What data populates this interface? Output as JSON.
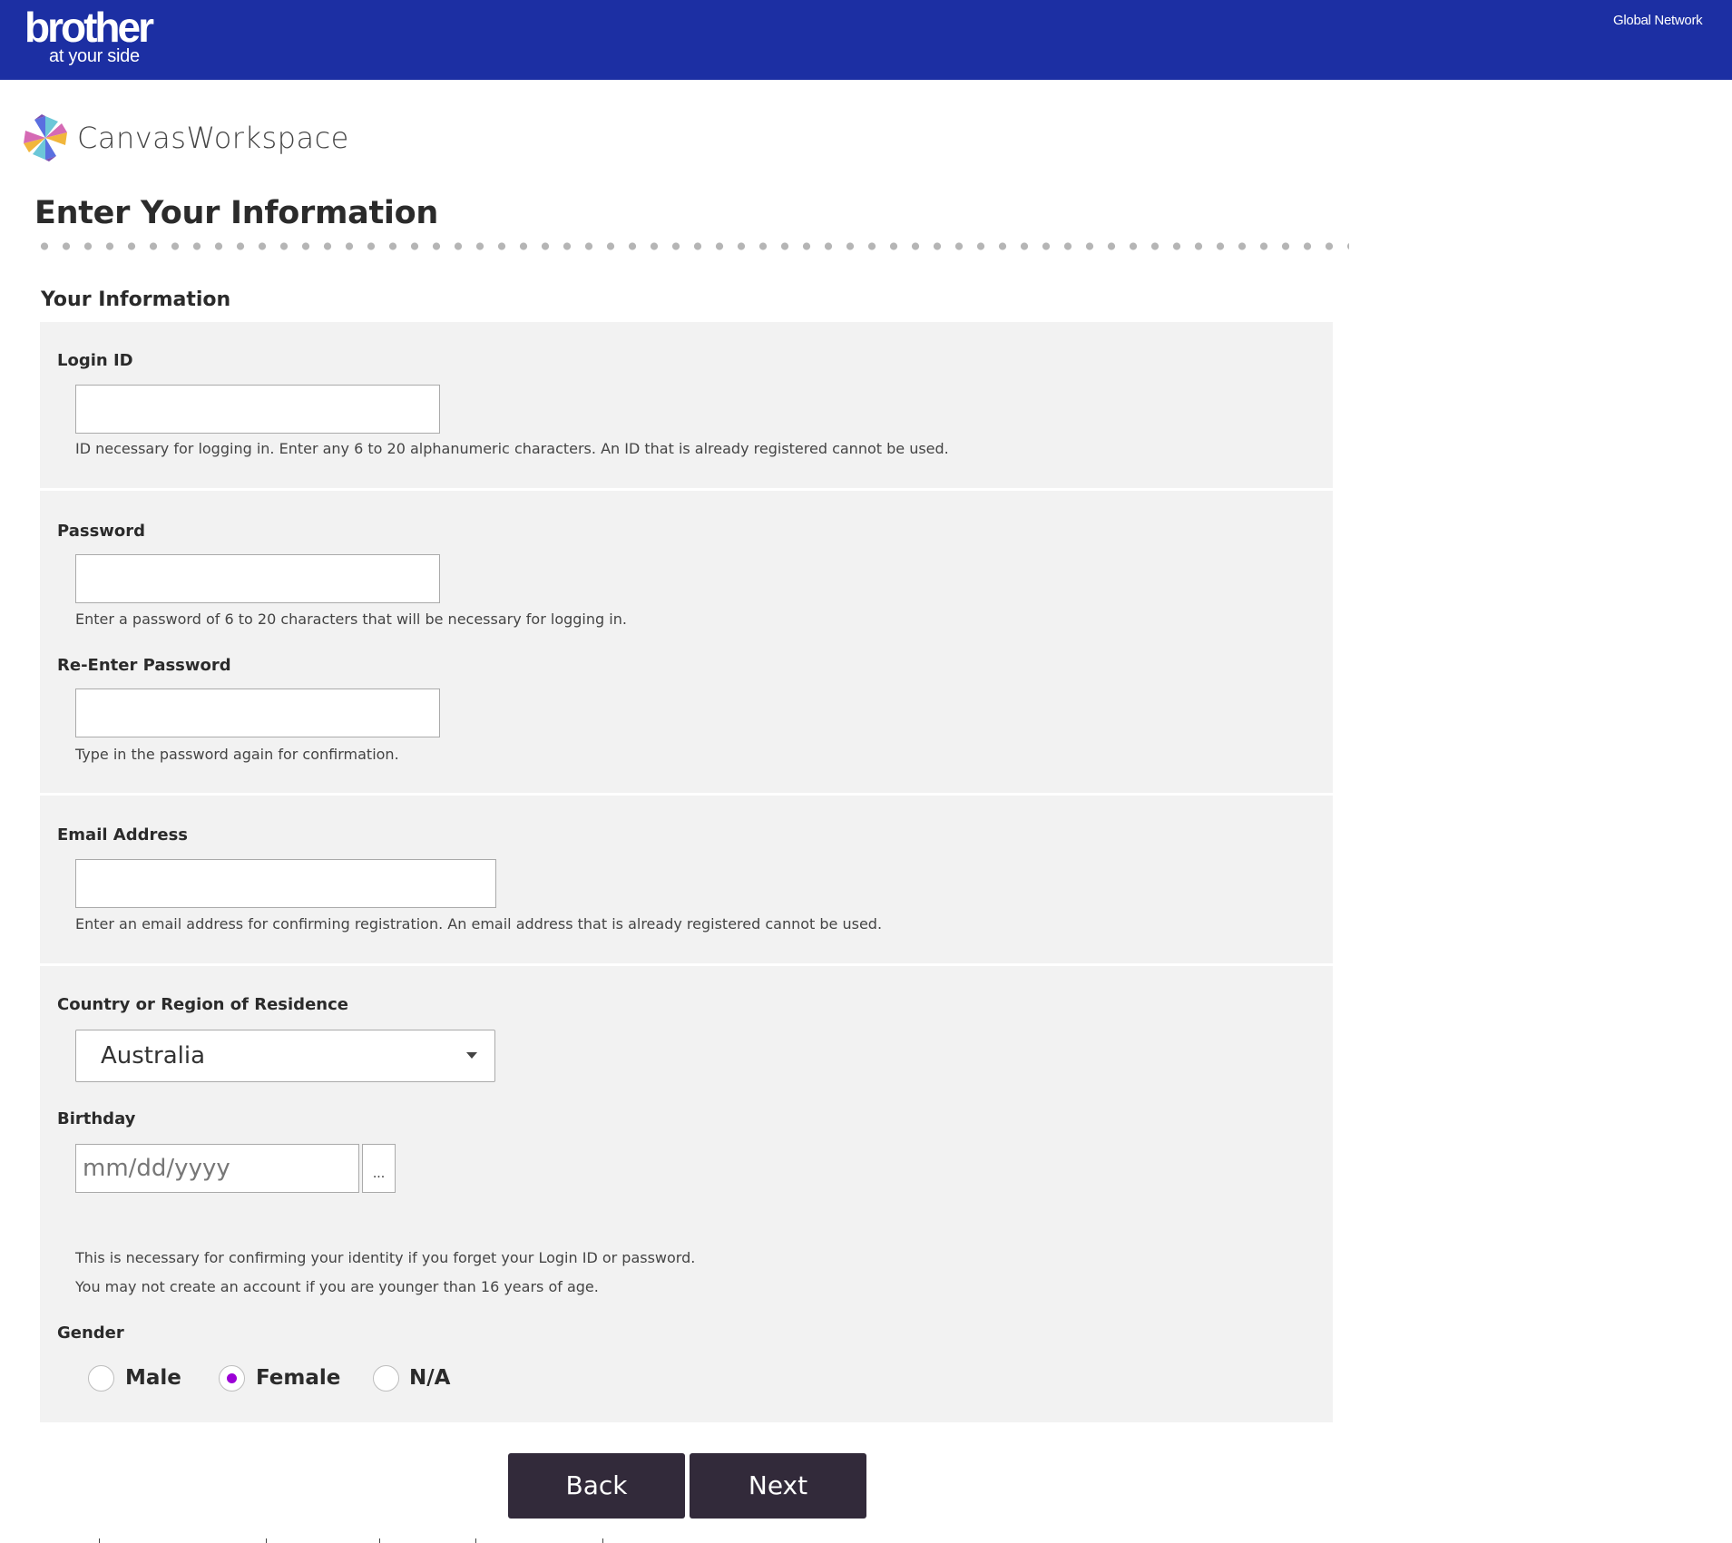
{
  "header": {
    "brand": "brother",
    "tagline": "at your side",
    "global_network_link": "Global Network",
    "background_color": "#1c2fa3"
  },
  "app": {
    "logo_icon": "canvas-workspace-star-icon",
    "name": "CanvasWorkspace"
  },
  "page": {
    "title": "Enter Your Information",
    "section_title": "Your Information"
  },
  "form": {
    "login_id": {
      "label": "Login ID",
      "value": "",
      "help": "ID necessary for logging in. Enter any 6 to 20 alphanumeric characters. An ID that is already registered cannot be used."
    },
    "password": {
      "label": "Password",
      "value": "",
      "help": "Enter a password of 6 to 20 characters that will be necessary for logging in."
    },
    "reenter_password": {
      "label": "Re-Enter Password",
      "value": "",
      "help": "Type in the password again for confirmation."
    },
    "email": {
      "label": "Email Address",
      "value": "",
      "help": "Enter an email address for confirming registration. An email address that is already registered cannot be used."
    },
    "country": {
      "label": "Country or Region of Residence",
      "selected": "Australia",
      "icon": "chevron-down-icon"
    },
    "birthday": {
      "label": "Birthday",
      "value": "",
      "placeholder": "mm/dd/yyyy",
      "picker_label": "...",
      "help_lines": [
        "This is necessary for confirming your identity if you forget your Login ID or password.",
        "You may not create an account if you are younger than 16 years of age."
      ]
    },
    "gender": {
      "label": "Gender",
      "options": [
        {
          "label": "Male",
          "checked": false
        },
        {
          "label": "Female",
          "checked": true
        },
        {
          "label": "N/A",
          "checked": false
        }
      ],
      "selected_color": "#9b00d6"
    }
  },
  "actions": {
    "back_label": "Back",
    "next_label": "Next",
    "button_color": "#322a3a"
  }
}
